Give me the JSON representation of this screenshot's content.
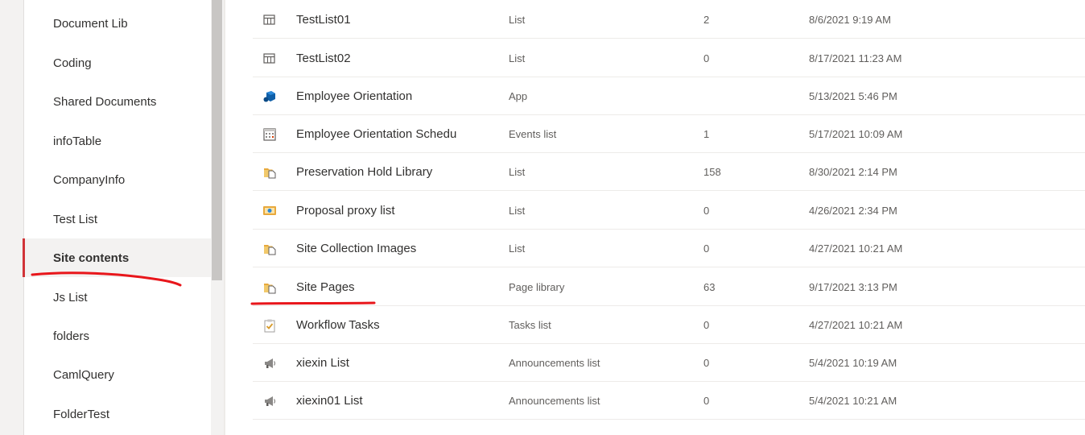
{
  "nav": {
    "items": [
      {
        "label": "Document Lib"
      },
      {
        "label": "Coding"
      },
      {
        "label": "Shared Documents"
      },
      {
        "label": "infoTable"
      },
      {
        "label": "CompanyInfo"
      },
      {
        "label": "Test List"
      },
      {
        "label": "Site contents",
        "selected": true
      },
      {
        "label": "Js List"
      },
      {
        "label": "folders"
      },
      {
        "label": "CamlQuery"
      },
      {
        "label": "FolderTest"
      }
    ]
  },
  "contents": {
    "rows": [
      {
        "icon": "list-icon",
        "name": "TestList01",
        "type": "List",
        "items": "2",
        "modified": "8/6/2021 9:19 AM"
      },
      {
        "icon": "list-icon",
        "name": "TestList02",
        "type": "List",
        "items": "0",
        "modified": "8/17/2021 11:23 AM"
      },
      {
        "icon": "app-icon",
        "name": "Employee Orientation",
        "type": "App",
        "items": "",
        "modified": "5/13/2021 5:46 PM"
      },
      {
        "icon": "calendar-icon",
        "name": "Employee Orientation Schedu",
        "type": "Events list",
        "items": "1",
        "modified": "5/17/2021 10:09 AM"
      },
      {
        "icon": "library-icon",
        "name": "Preservation Hold Library",
        "type": "List",
        "items": "158",
        "modified": "8/30/2021 2:14 PM"
      },
      {
        "icon": "picture-library-icon",
        "name": "Proposal proxy list",
        "type": "List",
        "items": "0",
        "modified": "4/26/2021 2:34 PM"
      },
      {
        "icon": "library-icon",
        "name": "Site Collection Images",
        "type": "List",
        "items": "0",
        "modified": "4/27/2021 10:21 AM"
      },
      {
        "icon": "library-icon",
        "name": "Site Pages",
        "type": "Page library",
        "items": "63",
        "modified": "9/17/2021 3:13 PM"
      },
      {
        "icon": "tasks-icon",
        "name": "Workflow Tasks",
        "type": "Tasks list",
        "items": "0",
        "modified": "4/27/2021 10:21 AM"
      },
      {
        "icon": "megaphone-icon",
        "name": "xiexin List",
        "type": "Announcements list",
        "items": "0",
        "modified": "5/4/2021 10:19 AM"
      },
      {
        "icon": "megaphone-icon",
        "name": "xiexin01 List",
        "type": "Announcements list",
        "items": "0",
        "modified": "5/4/2021 10:21 AM"
      }
    ]
  },
  "colors": {
    "accent_selected": "#d13438",
    "annotation_red": "#e8161b",
    "app_icon_blue": "#0f5fa8",
    "library_icon_orange": "#e8a93c"
  }
}
